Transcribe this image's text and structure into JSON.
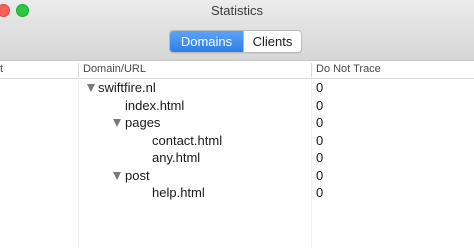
{
  "window": {
    "title": "Statistics"
  },
  "segmented": {
    "domains": "Domains",
    "clients": "Clients"
  },
  "table": {
    "columns": [
      "t",
      "Domain/URL",
      "Do Not Trace"
    ],
    "rows": [
      {
        "name": "swiftfire.nl",
        "value": "0"
      },
      {
        "name": "index.html",
        "value": "0"
      },
      {
        "name": "pages",
        "value": "0"
      },
      {
        "name": "contact.html",
        "value": "0"
      },
      {
        "name": "any.html",
        "value": "0"
      },
      {
        "name": "post",
        "value": "0"
      },
      {
        "name": "help.html",
        "value": "0"
      }
    ]
  }
}
